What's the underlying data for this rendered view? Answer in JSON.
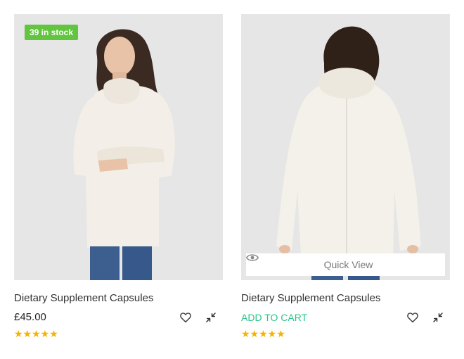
{
  "products": [
    {
      "title": "Dietary Supplement Capsules",
      "price": "£45.00",
      "stock_badge": "39 in stock",
      "rating_stars": "★★★★★",
      "rating": 5,
      "icons": [
        "wishlist-heart-icon",
        "compare-arrows-icon"
      ]
    },
    {
      "title": "Dietary Supplement Capsules",
      "add_to_cart": "ADD TO CART",
      "quick_view": "Quick View",
      "rating_stars": "★★★★★",
      "rating": 5,
      "icons": [
        "eye-icon",
        "wishlist-heart-icon",
        "compare-arrows-icon"
      ]
    }
  ],
  "colors": {
    "badge": "#62c53f",
    "add_to_cart": "#2bc48a",
    "stars": "#f5b301",
    "image_bg": "#e6e6e6"
  }
}
